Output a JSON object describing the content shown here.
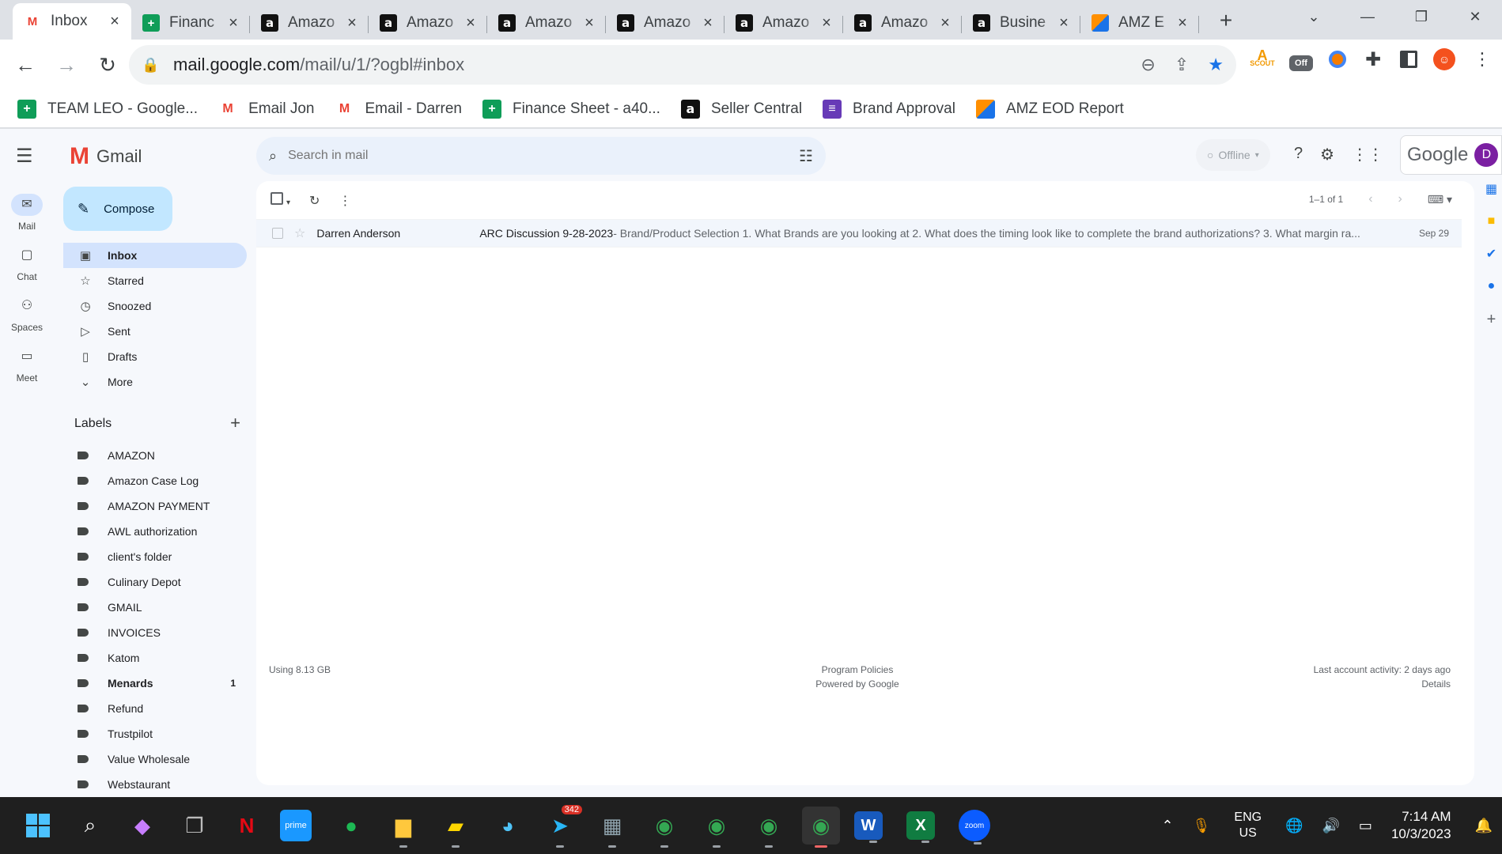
{
  "browser": {
    "tabs": [
      {
        "title": "Inbox",
        "icon": "gmail-icon",
        "active": true
      },
      {
        "title": "Financ",
        "icon": "sheets-icon"
      },
      {
        "title": "Amazo",
        "icon": "amazon-icon"
      },
      {
        "title": "Amazo",
        "icon": "amazon-icon"
      },
      {
        "title": "Amazo",
        "icon": "amazon-icon"
      },
      {
        "title": "Amazo",
        "icon": "amazon-icon"
      },
      {
        "title": "Amazo",
        "icon": "amazon-icon"
      },
      {
        "title": "Amazo",
        "icon": "amazon-icon"
      },
      {
        "title": "Busine",
        "icon": "amazon-icon"
      },
      {
        "title": "AMZ E",
        "icon": "amz-eod-icon"
      }
    ],
    "new_tab": "+",
    "url_host": "mail.google.com",
    "url_path": "/mail/u/1/?ogbl#inbox",
    "bookmarks": [
      {
        "label": "TEAM LEO - Google...",
        "icon": "sheets-icon"
      },
      {
        "label": "Email Jon",
        "icon": "gmail-icon"
      },
      {
        "label": "Email - Darren",
        "icon": "gmail-icon"
      },
      {
        "label": "Finance Sheet - a40...",
        "icon": "sheets-icon"
      },
      {
        "label": "Seller Central",
        "icon": "amazon-icon"
      },
      {
        "label": "Brand Approval",
        "icon": "forms-icon"
      },
      {
        "label": "AMZ EOD Report",
        "icon": "amz-eod-icon"
      }
    ],
    "extensions": {
      "scout": "SCOUT",
      "off": "Off"
    }
  },
  "gmail": {
    "app_name": "Gmail",
    "rail": [
      {
        "label": "Mail",
        "icon": "mail-icon"
      },
      {
        "label": "Chat",
        "icon": "chat-icon"
      },
      {
        "label": "Spaces",
        "icon": "spaces-icon"
      },
      {
        "label": "Meet",
        "icon": "meet-icon"
      }
    ],
    "search_placeholder": "Search in mail",
    "status": "Offline",
    "google_label": "Google",
    "avatar_letter": "D",
    "compose_label": "Compose",
    "nav": [
      {
        "label": "Inbox",
        "icon": "inbox-icon"
      },
      {
        "label": "Starred",
        "icon": "star-icon"
      },
      {
        "label": "Snoozed",
        "icon": "clock-icon"
      },
      {
        "label": "Sent",
        "icon": "send-icon"
      },
      {
        "label": "Drafts",
        "icon": "draft-icon"
      },
      {
        "label": "More",
        "icon": "chevron-down-icon"
      }
    ],
    "labels_title": "Labels",
    "labels": [
      {
        "name": "AMAZON"
      },
      {
        "name": "Amazon Case Log"
      },
      {
        "name": "AMAZON PAYMENT"
      },
      {
        "name": "AWL authorization"
      },
      {
        "name": "client's folder"
      },
      {
        "name": "Culinary Depot"
      },
      {
        "name": "GMAIL"
      },
      {
        "name": "INVOICES"
      },
      {
        "name": "Katom"
      },
      {
        "name": "Menards",
        "count": "1"
      },
      {
        "name": "Refund"
      },
      {
        "name": "Trustpilot"
      },
      {
        "name": "Value Wholesale"
      },
      {
        "name": "Webstaurant"
      }
    ],
    "pagination": "1–1 of 1",
    "emails": [
      {
        "from": "Darren Anderson",
        "subject": "ARC Discussion 9-28-2023",
        "snippet": " - Brand/Product Selection 1. What Brands are you looking at 2. What does the timing look like to complete the brand authorizations? 3. What margin ra...",
        "date": "Sep 29"
      }
    ],
    "footer": {
      "storage": "Using 8.13 GB",
      "policies": "Program Policies",
      "powered": "Powered by Google",
      "activity": "Last account activity: 2 days ago",
      "details": "Details"
    }
  },
  "taskbar": {
    "telegram_badge": "342",
    "lang_1": "ENG",
    "lang_2": "US",
    "time": "7:14 AM",
    "date": "10/3/2023"
  }
}
